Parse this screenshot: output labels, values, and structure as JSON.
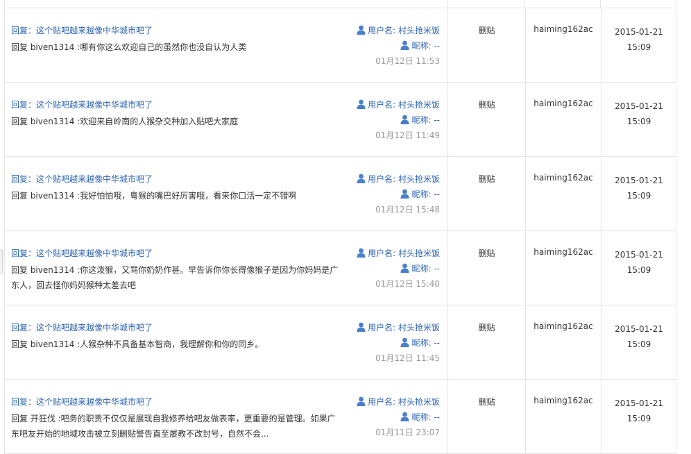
{
  "colors": {
    "link": "#2d64b3",
    "muted": "#999999",
    "border": "#e4e4e4"
  },
  "icons": {
    "user": "person-icon"
  },
  "rows": [
    {
      "title": "回复：这个贴吧越来越像中华城市吧了",
      "body": "回复 biven1314 :哪有你这么欢迎自己的虽然你也没自认为人类",
      "username": "用户名: 村头抢米饭",
      "nickname": "昵称: --",
      "post_time": "01月12日 11:53",
      "action": "删贴",
      "operator": "haiming162ac",
      "op_date": "2015-01-21",
      "op_time": "15:09"
    },
    {
      "title": "回复：这个贴吧越来越像中华城市吧了",
      "body": "回复 biven1314 :欢迎来自岭南的人猴杂交种加入贴吧大家庭",
      "username": "用户名: 村头抢米饭",
      "nickname": "昵称: --",
      "post_time": "01月12日 11:49",
      "action": "删贴",
      "operator": "haiming162ac",
      "op_date": "2015-01-21",
      "op_time": "15:09"
    },
    {
      "title": "回复：这个贴吧越来越像中华城市吧了",
      "body": "回复 biven1314 :我好怕怕哦，粤猴的嘴巴好厉害哦，看来你口活一定不错啊",
      "username": "用户名: 村头抢米饭",
      "nickname": "昵称: --",
      "post_time": "01月12日 15:48",
      "action": "删贴",
      "operator": "haiming162ac",
      "op_date": "2015-01-21",
      "op_time": "15:09"
    },
    {
      "title": "回复：这个贴吧越来越像中华城市吧了",
      "body": "回复 biven1314 :你这泼猴，又骂你奶奶作甚。早告诉你你长得像猴子是因为你妈妈是广东人，回去怪你妈妈猴种太差去吧",
      "username": "用户名: 村头抢米饭",
      "nickname": "昵称: --",
      "post_time": "01月12日 15:40",
      "action": "删贴",
      "operator": "haiming162ac",
      "op_date": "2015-01-21",
      "op_time": "15:09"
    },
    {
      "title": "回复：这个贴吧越来越像中华城市吧了",
      "body": "回复 biven1314 :人猴杂种不具备基本智商，我理解你和你的同乡。",
      "username": "用户名: 村头抢米饭",
      "nickname": "昵称: --",
      "post_time": "01月12日 11:45",
      "action": "删贴",
      "operator": "haiming162ac",
      "op_date": "2015-01-21",
      "op_time": "15:09"
    },
    {
      "title": "回复：这个贴吧越来越像中华城市吧了",
      "body": "回复 开狂伐 :吧务的职责不仅仅是展现自我修养给吧友做表率，更重要的是管理。如果广东吧友开始的地域攻击被立刻删贴警告直至屡教不改封号，自然不会...",
      "username": "用户名: 村头抢米饭",
      "nickname": "昵称: --",
      "post_time": "01月11日 23:07",
      "action": "删贴",
      "operator": "haiming162ac",
      "op_date": "2015-01-21",
      "op_time": "15:09"
    }
  ]
}
